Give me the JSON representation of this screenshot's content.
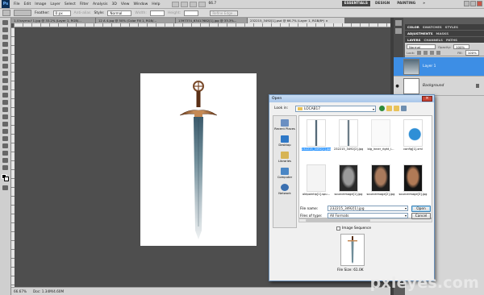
{
  "app": {
    "logo": "Ps",
    "menu": [
      "File",
      "Edit",
      "Image",
      "Layer",
      "Select",
      "Filter",
      "Analysis",
      "3D",
      "View",
      "Window",
      "Help"
    ],
    "zoom": "66.7",
    "workspaces": [
      "ESSENTIALS",
      "DESIGN",
      "PAINTING",
      "»"
    ]
  },
  "options_bar": {
    "feather_label": "Feather:",
    "feather_value": "0 px",
    "antialias_label": "Anti-alias",
    "style_label": "Style:",
    "style_value": "Normal",
    "width_label": "Width:",
    "height_label": "Height:",
    "refine_edge": "Refine Edge..."
  },
  "doc_tabs": [
    "1.4 kaymo.f 1.jpg @ 33.2% (Layer 1, RGB/...",
    "12 A 4.jpg @ 50% (Color Fill 1, RGB/...",
    "1397374_63417682[1].jpg @ 33.3%...",
    "232215_3492[1].psd @ 66.7% (Layer 1, RGB/8*) ×"
  ],
  "status": {
    "zoom": "66.67%",
    "doc": "Doc: 1.34M/4.60M"
  },
  "panels": {
    "top_tabs": [
      "COLOR",
      "SWATCHES",
      "STYLES"
    ],
    "mid_tabs": [
      "ADJUSTMENTS",
      "MASKS"
    ],
    "layer_tabs": [
      "LAYERS",
      "CHANNELS",
      "PATHS"
    ],
    "blend_mode": "Normal",
    "opacity_label": "Opacity:",
    "opacity_value": "100%",
    "lock_label": "Lock:",
    "fill_label": "Fill:",
    "fill_value": "100%",
    "layers": [
      {
        "name": "Layer 1",
        "selected": true
      },
      {
        "name": "Background",
        "selected": false
      }
    ]
  },
  "dialog": {
    "title": "Open",
    "close": "×",
    "look_in_label": "Look in:",
    "look_in_value": "LOCAB17",
    "places": [
      "Recent Places",
      "Desktop",
      "Libraries",
      "Computer",
      "Network"
    ],
    "files": [
      {
        "name": "232215_3492[1].jpg",
        "selected": true
      },
      {
        "name": "232215_3492[2].jpg",
        "selected": false
      },
      {
        "name": "big_inner_right_i...",
        "selected": false
      },
      {
        "name": "config[1].xml",
        "selected": false
      },
      {
        "name": "oldpointip[1].spu...",
        "selected": false
      },
      {
        "name": "sourceimage[1].jpg",
        "selected": false
      },
      {
        "name": "sourceimage[2].jpg",
        "selected": false
      },
      {
        "name": "sourceimage[3].jpg",
        "selected": false
      }
    ],
    "file_name_label": "File name:",
    "file_name_value": "232215_3492[1].jpg",
    "file_type_label": "Files of type:",
    "file_type_value": "All Formats",
    "open_button": "Open",
    "cancel_button": "Cancel",
    "image_sequence": "Image Sequence",
    "file_size": "File Size: 61.0K"
  },
  "watermark": "pxleyes.com"
}
